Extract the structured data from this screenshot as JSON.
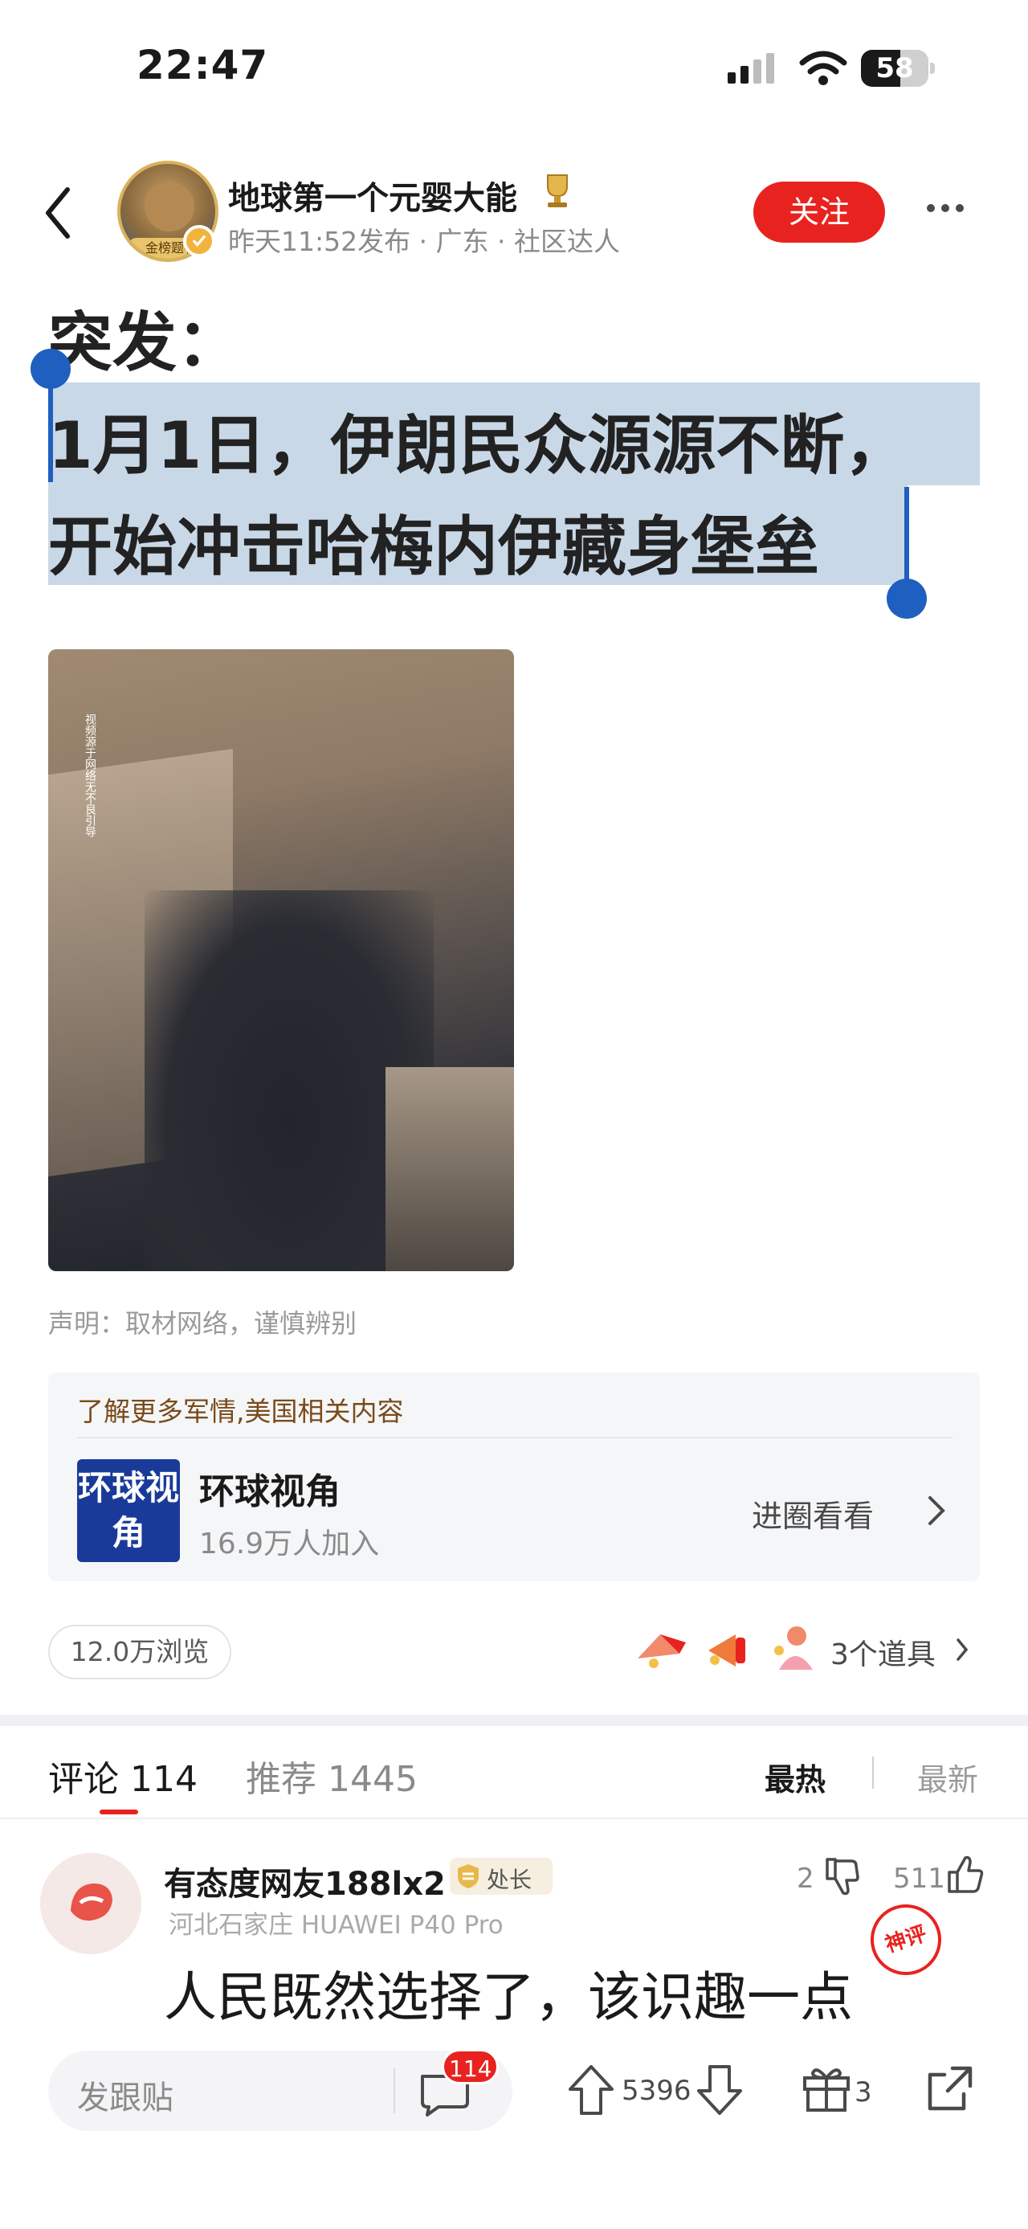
{
  "status_bar": {
    "time": "22:47",
    "battery": "58",
    "battery_level": 0.58
  },
  "header": {
    "author_name": "地球第一个元婴大能",
    "meta": "昨天11:52发布 · 广东 · 社区达人",
    "follow_label": "关注",
    "avatar_badge": "金榜题名"
  },
  "post": {
    "title_line0": "突发：",
    "title_line1": "1月1日，伊朗民众源源不断，",
    "title_line2": "开始冲击哈梅内伊藏身堡垒",
    "disclaimer": "声明：取材网络，谨慎辨别",
    "media_watermark": "视频源于网络无不良引导"
  },
  "promo": {
    "header": "了解更多军情,美国相关内容",
    "logo_text": "环球视角",
    "title": "环球视角",
    "subtitle": "16.9万人加入",
    "action": "进圈看看"
  },
  "stats": {
    "views": "12.0万浏览",
    "props": "3个道具"
  },
  "tabs": {
    "comments": "评论 114",
    "recommend": "推荐 1445",
    "sort_hot": "最热",
    "sort_new": "最新"
  },
  "comment": {
    "name": "有态度网友188lx2",
    "rank": "处长",
    "meta": "河北石家庄 HUAWEI P40 Pro",
    "text": "人民既然选择了，该识趣一点",
    "dislikes": "2",
    "likes": "511",
    "stamp": "神评"
  },
  "bottom_bar": {
    "reply_placeholder": "发跟贴",
    "comment_badge": "114",
    "vote_count": "5396",
    "gift_count": "3"
  },
  "colors": {
    "accent": "#e8231f",
    "selection": "#c9d8e7",
    "handle": "#1f5fbf"
  },
  "icons": [
    "back-icon",
    "signal-icon",
    "wifi-icon",
    "more-icon",
    "trophy-icon",
    "verify-icon",
    "chevron-right-icon",
    "thumbs-down-icon",
    "thumbs-up-icon",
    "comment-icon",
    "upvote-icon",
    "downvote-icon",
    "gift-icon",
    "share-icon"
  ]
}
